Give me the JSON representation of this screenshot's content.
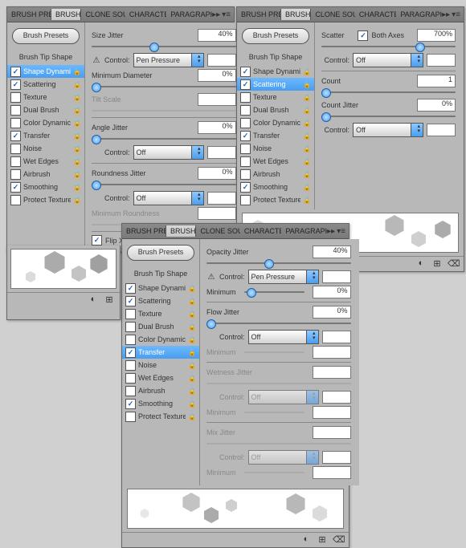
{
  "tabs": [
    "BRUSH PRE",
    "BRUSH",
    "CLONE SOU",
    "CHARACTE",
    "PARAGRAPH"
  ],
  "presets_btn": "Brush Presets",
  "sidebar": {
    "tip": "Brush Tip Shape",
    "items": [
      {
        "label": "Shape Dynamics",
        "on": true,
        "lock": true
      },
      {
        "label": "Scattering",
        "on": true,
        "lock": true
      },
      {
        "label": "Texture",
        "on": false,
        "lock": true
      },
      {
        "label": "Dual Brush",
        "on": false,
        "lock": true
      },
      {
        "label": "Color Dynamics",
        "on": false,
        "lock": true
      },
      {
        "label": "Transfer",
        "on": true,
        "lock": true
      },
      {
        "label": "Noise",
        "on": false,
        "lock": true
      },
      {
        "label": "Wet Edges",
        "on": false,
        "lock": true
      },
      {
        "label": "Airbrush",
        "on": false,
        "lock": true
      },
      {
        "label": "Smoothing",
        "on": true,
        "lock": true
      },
      {
        "label": "Protect Texture",
        "on": false,
        "lock": true
      }
    ]
  },
  "panelA": {
    "sel": 0,
    "size_jitter": {
      "label": "Size Jitter",
      "val": "40%",
      "pos": 40
    },
    "control1": {
      "label": "Control:",
      "val": "Pen Pressure",
      "warn": true,
      "box": ""
    },
    "min_diam": {
      "label": "Minimum Diameter",
      "val": "0%",
      "pos": 0
    },
    "tilt": {
      "label": "Tilt Scale",
      "val": "",
      "dim": true
    },
    "angle": {
      "label": "Angle Jitter",
      "val": "0%",
      "pos": 0
    },
    "control2": {
      "label": "Control:",
      "val": "Off",
      "box": ""
    },
    "round": {
      "label": "Roundness Jitter",
      "val": "0%",
      "pos": 0
    },
    "control3": {
      "label": "Control:",
      "val": "Off",
      "box": ""
    },
    "min_round": {
      "label": "Minimum Roundness",
      "val": "",
      "dim": true
    },
    "flipx": {
      "label": "Flip X",
      "on": true
    }
  },
  "panelB": {
    "sel": 1,
    "scatter": {
      "label": "Scatter",
      "axes": "Both Axes",
      "axes_on": true,
      "val": "700%",
      "pos": 70
    },
    "control1": {
      "label": "Control:",
      "val": "Off",
      "box": ""
    },
    "count": {
      "label": "Count",
      "val": "1",
      "pos": 0
    },
    "cjitter": {
      "label": "Count Jitter",
      "val": "0%",
      "pos": 0
    },
    "control2": {
      "label": "Control:",
      "val": "Off",
      "box": ""
    }
  },
  "panelC": {
    "sel": 5,
    "opacity": {
      "label": "Opacity Jitter",
      "val": "40%",
      "pos": 40
    },
    "control1": {
      "label": "Control:",
      "val": "Pen Pressure",
      "warn": true,
      "box": ""
    },
    "min1": {
      "label": "Minimum",
      "val": "0%",
      "pos": 4
    },
    "flow": {
      "label": "Flow Jitter",
      "val": "0%",
      "pos": 0
    },
    "control2": {
      "label": "Control:",
      "val": "Off",
      "box": ""
    },
    "min2": {
      "label": "Minimum",
      "val": "",
      "dim": true
    },
    "wet": {
      "label": "Wetness Jitter",
      "val": "",
      "dim": true
    },
    "control3": {
      "label": "Control:",
      "val": "Off",
      "box": "",
      "dim": true
    },
    "min3": {
      "label": "Minimum",
      "val": "",
      "dim": true
    },
    "mix": {
      "label": "Mix Jitter",
      "val": "",
      "dim": true
    },
    "control4": {
      "label": "Control:",
      "val": "Off",
      "box": "",
      "dim": true
    },
    "min4": {
      "label": "Minimum",
      "val": "",
      "dim": true
    }
  }
}
